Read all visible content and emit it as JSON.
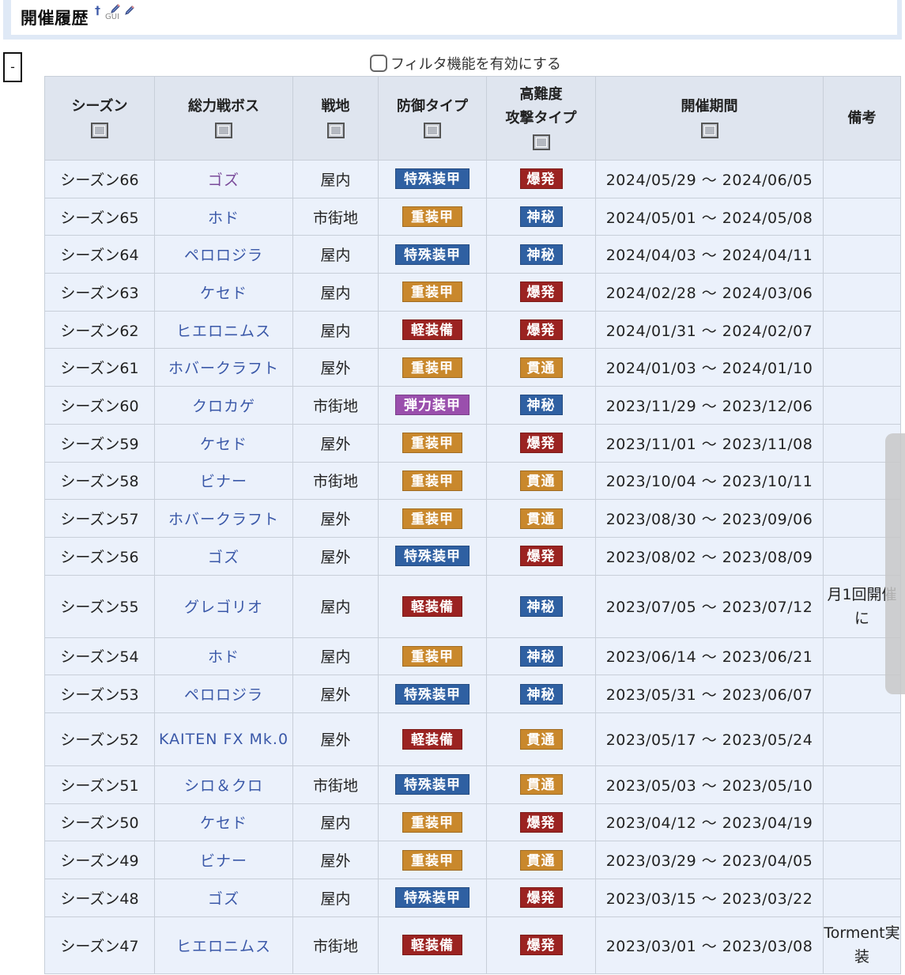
{
  "section": {
    "title": "開催履歴",
    "plus_link": "†",
    "gui_link": "GUI"
  },
  "toggle": {
    "label": "-"
  },
  "filter": {
    "label": "フィルタ機能を有効にする",
    "checked": false
  },
  "table": {
    "headers": [
      "シーズン",
      "総力戦ボス",
      "戦地",
      "防御タイプ",
      "高難度",
      "攻撃タイプ",
      "開催期間",
      "備考"
    ],
    "tag_colors": {
      "特殊装甲": "#2f60a2",
      "重装甲": "#c9882c",
      "軽装備": "#9b2321",
      "弾力装甲": "#9a4fad",
      "爆発": "#9b2321",
      "神秘": "#2f60a2",
      "貫通": "#c9882c"
    },
    "rows": [
      {
        "season": "シーズン66",
        "boss": "ゴズ",
        "field": "屋内",
        "defense": "特殊装甲",
        "attack": "爆発",
        "period": "2024/05/29 〜 2024/06/05",
        "notes": ""
      },
      {
        "season": "シーズン65",
        "boss": "ホド",
        "field": "市街地",
        "defense": "重装甲",
        "attack": "神秘",
        "period": "2024/05/01 〜 2024/05/08",
        "notes": ""
      },
      {
        "season": "シーズン64",
        "boss": "ペロロジラ",
        "field": "屋内",
        "defense": "特殊装甲",
        "attack": "神秘",
        "period": "2024/04/03 〜 2024/04/11",
        "notes": ""
      },
      {
        "season": "シーズン63",
        "boss": "ケセド",
        "field": "屋内",
        "defense": "重装甲",
        "attack": "爆発",
        "period": "2024/02/28 〜 2024/03/06",
        "notes": ""
      },
      {
        "season": "シーズン62",
        "boss": "ヒエロニムス",
        "field": "屋内",
        "defense": "軽装備",
        "attack": "爆発",
        "period": "2024/01/31 〜 2024/02/07",
        "notes": ""
      },
      {
        "season": "シーズン61",
        "boss": "ホバークラフト",
        "field": "屋外",
        "defense": "重装甲",
        "attack": "貫通",
        "period": "2024/01/03 〜 2024/01/10",
        "notes": ""
      },
      {
        "season": "シーズン60",
        "boss": "クロカゲ",
        "field": "市街地",
        "defense": "弾力装甲",
        "attack": "神秘",
        "period": "2023/11/29 〜 2023/12/06",
        "notes": ""
      },
      {
        "season": "シーズン59",
        "boss": "ケセド",
        "field": "屋外",
        "defense": "重装甲",
        "attack": "爆発",
        "period": "2023/11/01 〜 2023/11/08",
        "notes": ""
      },
      {
        "season": "シーズン58",
        "boss": "ビナー",
        "field": "市街地",
        "defense": "重装甲",
        "attack": "貫通",
        "period": "2023/10/04 〜 2023/10/11",
        "notes": ""
      },
      {
        "season": "シーズン57",
        "boss": "ホバークラフト",
        "field": "屋外",
        "defense": "重装甲",
        "attack": "貫通",
        "period": "2023/08/30 〜 2023/09/06",
        "notes": ""
      },
      {
        "season": "シーズン56",
        "boss": "ゴズ",
        "field": "屋外",
        "defense": "特殊装甲",
        "attack": "爆発",
        "period": "2023/08/02 〜 2023/08/09",
        "notes": ""
      },
      {
        "season": "シーズン55",
        "boss": "グレゴリオ",
        "field": "屋内",
        "defense": "軽装備",
        "attack": "神秘",
        "period": "2023/07/05 〜 2023/07/12",
        "notes": "月1回開催に"
      },
      {
        "season": "シーズン54",
        "boss": "ホド",
        "field": "屋内",
        "defense": "重装甲",
        "attack": "神秘",
        "period": "2023/06/14 〜 2023/06/21",
        "notes": ""
      },
      {
        "season": "シーズン53",
        "boss": "ペロロジラ",
        "field": "屋外",
        "defense": "特殊装甲",
        "attack": "神秘",
        "period": "2023/05/31 〜 2023/06/07",
        "notes": ""
      },
      {
        "season": "シーズン52",
        "boss": "KAITEN FX Mk.0",
        "field": "屋外",
        "defense": "軽装備",
        "attack": "貫通",
        "period": "2023/05/17 〜 2023/05/24",
        "notes": ""
      },
      {
        "season": "シーズン51",
        "boss": "シロ＆クロ",
        "field": "市街地",
        "defense": "特殊装甲",
        "attack": "貫通",
        "period": "2023/05/03 〜 2023/05/10",
        "notes": ""
      },
      {
        "season": "シーズン50",
        "boss": "ケセド",
        "field": "屋内",
        "defense": "重装甲",
        "attack": "爆発",
        "period": "2023/04/12 〜 2023/04/19",
        "notes": ""
      },
      {
        "season": "シーズン49",
        "boss": "ビナー",
        "field": "屋外",
        "defense": "重装甲",
        "attack": "貫通",
        "period": "2023/03/29 〜 2023/04/05",
        "notes": ""
      },
      {
        "season": "シーズン48",
        "boss": "ゴズ",
        "field": "屋内",
        "defense": "特殊装甲",
        "attack": "爆発",
        "period": "2023/03/15 〜 2023/03/22",
        "notes": ""
      },
      {
        "season": "シーズン47",
        "boss": "ヒエロニムス",
        "field": "市街地",
        "defense": "軽装備",
        "attack": "爆発",
        "period": "2023/03/01 〜 2023/03/08",
        "notes": "Torment実装"
      }
    ]
  }
}
